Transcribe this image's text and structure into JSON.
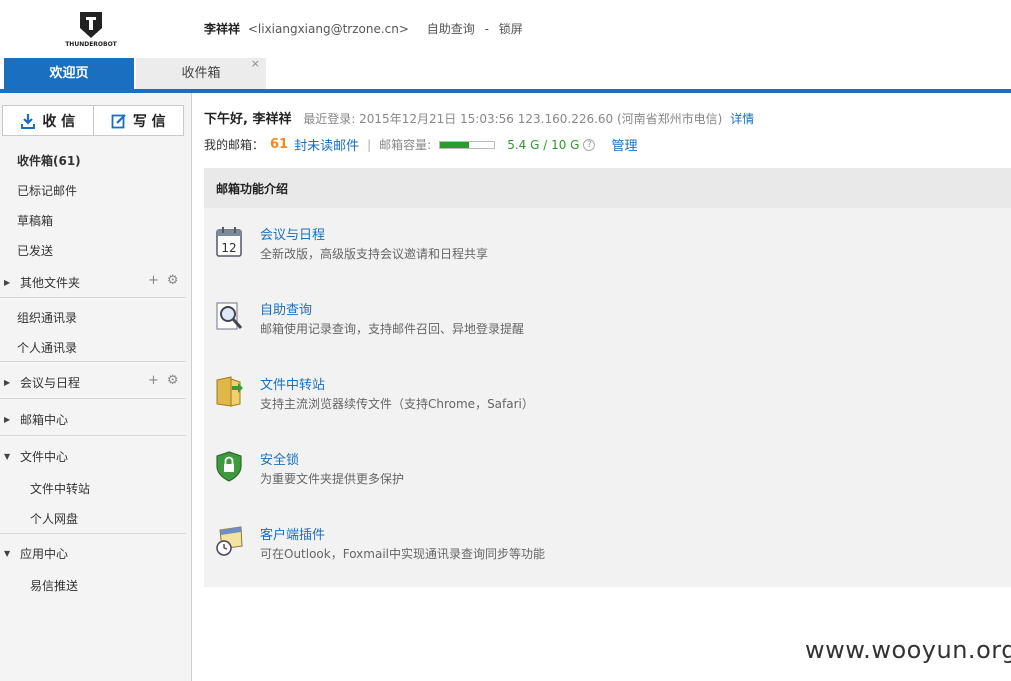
{
  "header": {
    "logo_text": "THUNDEROBOT",
    "user_name": "李祥祥",
    "user_email": "<lixiangxiang@trzone.cn>",
    "self_query": "自助查询",
    "separator": "-",
    "lock_screen": "锁屏"
  },
  "tabs": [
    {
      "label": "欢迎页"
    },
    {
      "label": "收件箱",
      "close": "×"
    }
  ],
  "sidebar": {
    "receive_label": "收 信",
    "compose_label": "写 信",
    "items": [
      {
        "label": "收件箱(61)"
      },
      {
        "label": "已标记邮件"
      },
      {
        "label": "草稿箱"
      },
      {
        "label": "已发送"
      }
    ],
    "other_folders": "其他文件夹",
    "contacts": [
      {
        "label": "组织通讯录"
      },
      {
        "label": "个人通讯录"
      }
    ],
    "calendar": "会议与日程",
    "mail_center": "邮箱中心",
    "file_center": "文件中心",
    "file_center_items": [
      {
        "label": "文件中转站"
      },
      {
        "label": "个人网盘"
      }
    ],
    "app_center": "应用中心",
    "app_center_items": [
      {
        "label": "易信推送"
      }
    ]
  },
  "main": {
    "greeting": "下午好, 李祥祥",
    "last_login": "最近登录: 2015年12月21日 15:03:56 123.160.226.60 (河南省郑州市电信)",
    "detail_link": "详情",
    "mailbox_label": "我的邮箱：",
    "unread_count": "61",
    "unread_label": "封未读邮件",
    "bar": "|",
    "capacity_label": "邮箱容量:",
    "capacity_fraction": 0.54,
    "capacity_value": "5.4 G / 10 G",
    "help": "?",
    "manage": "管理",
    "panel_title": "邮箱功能介绍",
    "features": [
      {
        "title": "会议与日程",
        "desc": "全新改版，高级版支持会议邀请和日程共享",
        "icon": "calendar-icon",
        "icon_text": "12"
      },
      {
        "title": "自助查询",
        "desc": "邮箱使用记录查询，支持邮件召回、异地登录提醒",
        "icon": "magnifier-icon"
      },
      {
        "title": "文件中转站",
        "desc": "支持主流浏览器续传文件（支持Chrome，Safari）",
        "icon": "folder-transfer-icon"
      },
      {
        "title": "安全锁",
        "desc": "为重要文件夹提供更多保护",
        "icon": "shield-lock-icon"
      },
      {
        "title": "客户端插件",
        "desc": "可在Outlook，Foxmail中实现通讯录查询同步等功能",
        "icon": "plugin-clock-icon"
      }
    ]
  },
  "watermark": "www.wooyun.org",
  "colors": {
    "accent": "#1a6fc1",
    "unread": "#f08a24",
    "capacity": "#2a9c2a"
  }
}
